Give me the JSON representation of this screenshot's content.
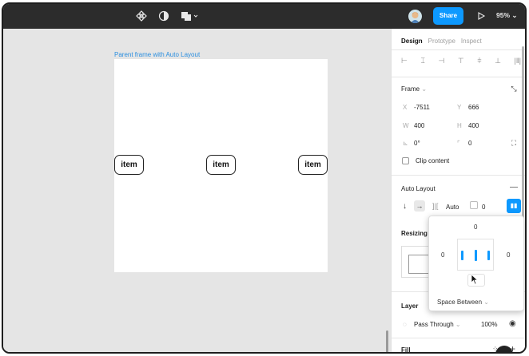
{
  "toolbar": {
    "share_label": "Share",
    "zoom": "95%"
  },
  "canvas": {
    "frame_label": "Parent frame with Auto Layout",
    "items": [
      "item",
      "item",
      "item"
    ]
  },
  "panel": {
    "tabs": [
      "Design",
      "Prototype",
      "Inspect"
    ],
    "frame": {
      "title": "Frame",
      "x_label": "X",
      "x_value": "-7511",
      "y_label": "Y",
      "y_value": "666",
      "w_label": "W",
      "w_value": "400",
      "h_label": "H",
      "h_value": "400",
      "rotation": "0°",
      "radius": "0",
      "clip_content": "Clip content"
    },
    "auto_layout": {
      "title": "Auto Layout",
      "spacing": "Auto",
      "padding": "0"
    },
    "resizing_title": "Resizing",
    "layer": {
      "title": "Layer",
      "blend": "Pass Through",
      "opacity": "100%"
    },
    "fill_title": "Fill"
  },
  "popover": {
    "top": "0",
    "left": "0",
    "right": "0",
    "distribution": "Space Between"
  },
  "colors": {
    "accent": "#0d99ff",
    "toolbar": "#2c2c2c",
    "canvas": "#e5e5e5"
  }
}
